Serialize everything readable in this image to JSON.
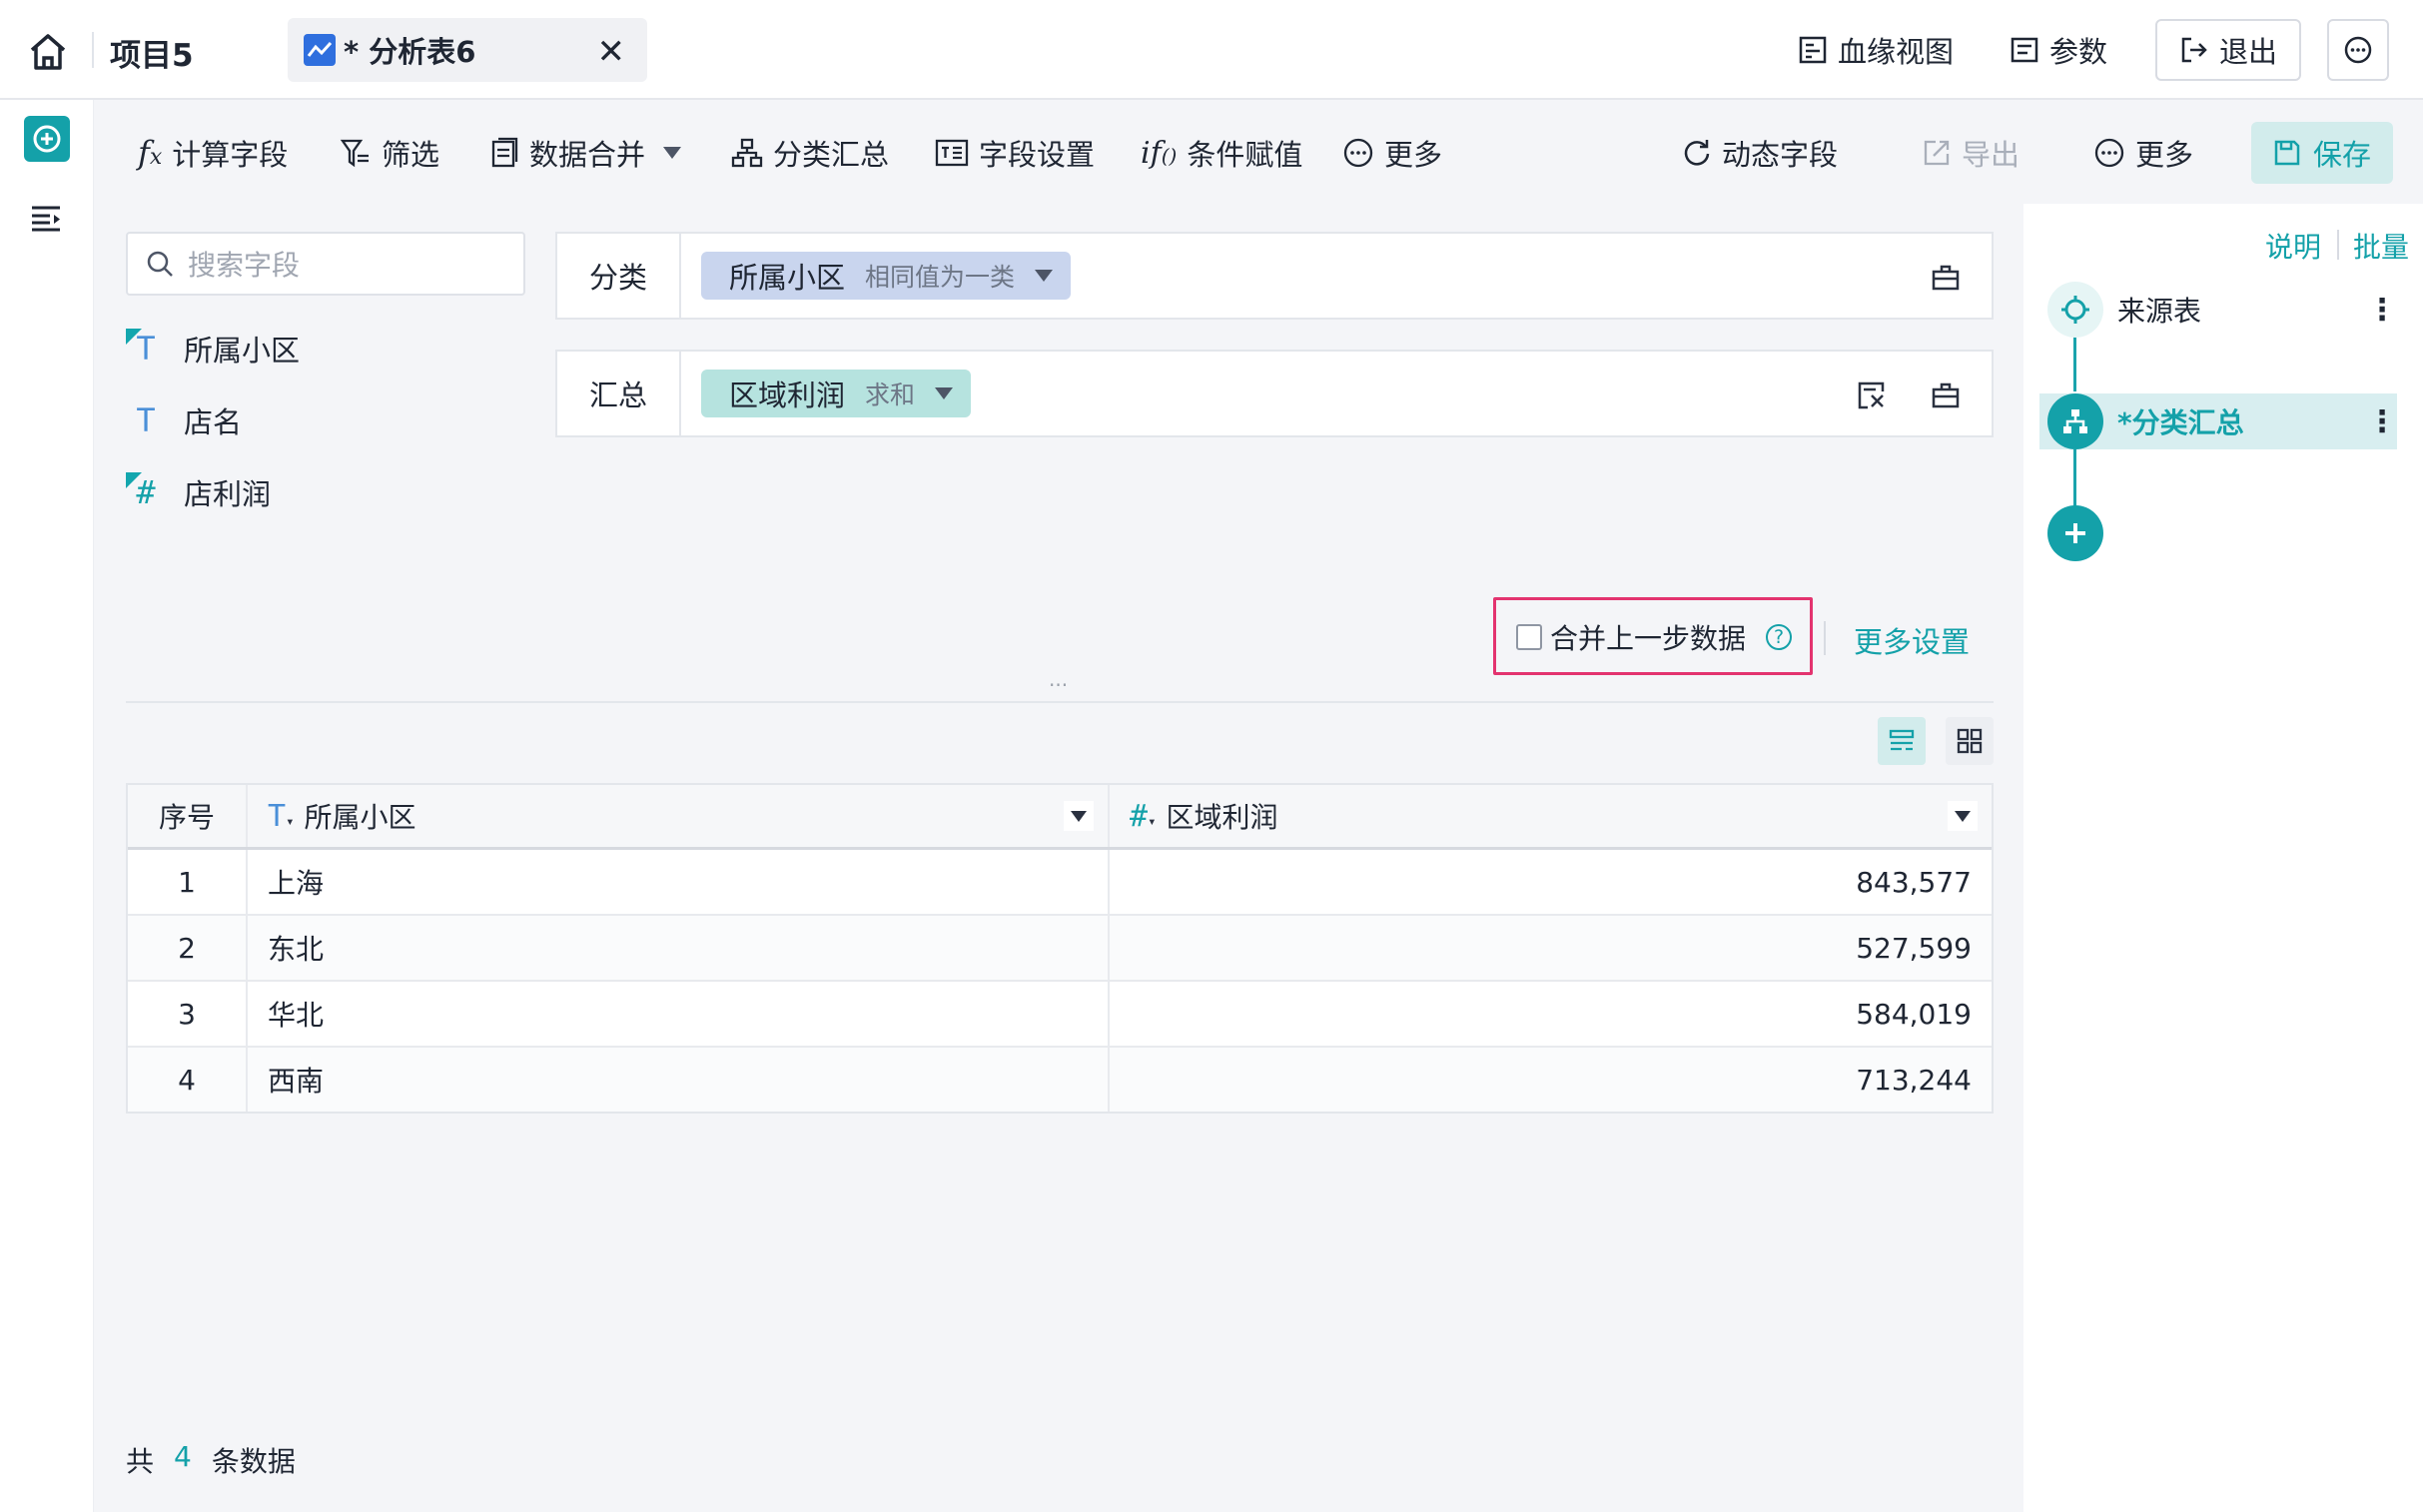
{
  "topbar": {
    "project": "项目5",
    "tab_title": "* 分析表6",
    "lineage": "血缘视图",
    "params": "参数",
    "exit": "退出"
  },
  "toolbar": {
    "calc_field": "计算字段",
    "filter": "筛选",
    "merge": "数据合并",
    "group_summary": "分类汇总",
    "field_settings": "字段设置",
    "conditional": "条件赋值",
    "more_left": "更多",
    "dynamic_field": "动态字段",
    "export": "导出",
    "more_right": "更多",
    "save": "保存"
  },
  "fields": {
    "search_placeholder": "搜索字段",
    "items": [
      {
        "name": "所属小区",
        "type": "T"
      },
      {
        "name": "店名",
        "type": "T"
      },
      {
        "name": "店利润",
        "type": "#"
      }
    ]
  },
  "config": {
    "group_label": "分类",
    "group_chip": {
      "field": "所属小区",
      "mode": "相同值为一类"
    },
    "summary_label": "汇总",
    "summary_chip": {
      "field": "区域利润",
      "mode": "求和"
    },
    "merge_prev_label": "合并上一步数据",
    "more_settings": "更多设置",
    "resize_handle": "..."
  },
  "table": {
    "columns": [
      "序号",
      "所属小区",
      "区域利润"
    ],
    "col_types": [
      "",
      "T",
      "#"
    ],
    "rows": [
      [
        "1",
        "上海",
        "843,577"
      ],
      [
        "2",
        "东北",
        "527,599"
      ],
      [
        "3",
        "华北",
        "584,019"
      ],
      [
        "4",
        "西南",
        "713,244"
      ]
    ]
  },
  "footer": {
    "prefix": "共",
    "count": "4",
    "suffix": "条数据"
  },
  "steps_panel": {
    "help": "说明",
    "batch": "批量",
    "steps": [
      {
        "label": "来源表",
        "active": false
      },
      {
        "label": "*分类汇总",
        "active": true
      }
    ]
  },
  "colors": {
    "accent": "#14a1a9",
    "highlight_border": "#e3336f",
    "group_chip_bg": "#c9d5ee",
    "summary_chip_bg": "#b6e3df"
  }
}
